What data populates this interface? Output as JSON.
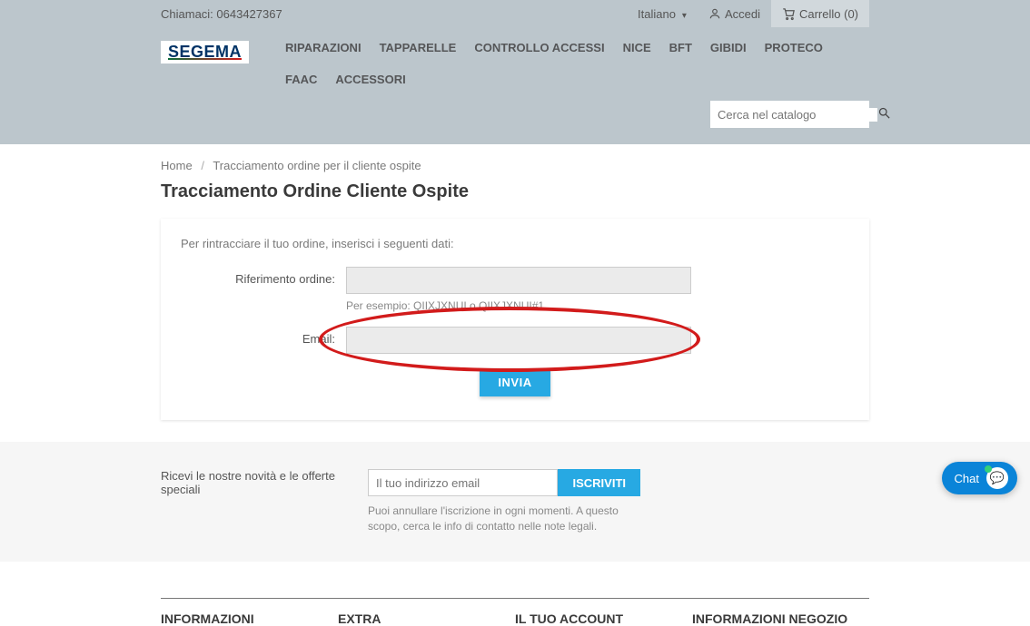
{
  "topbar": {
    "phone_label": "Chiamaci: 0643427367",
    "language": "Italiano",
    "login": "Accedi",
    "cart": "Carrello (0)"
  },
  "logo_text": "SEGEMA",
  "nav": [
    "RIPARAZIONI",
    "TAPPARELLE",
    "CONTROLLO ACCESSI",
    "NICE",
    "BFT",
    "GIBIDI",
    "PROTECO",
    "FAAC",
    "ACCESSORI"
  ],
  "search": {
    "placeholder": "Cerca nel catalogo"
  },
  "breadcrumb": {
    "home": "Home",
    "current": "Tracciamento ordine per il cliente ospite"
  },
  "page_title": "Tracciamento Ordine Cliente Ospite",
  "form": {
    "intro": "Per rintracciare il tuo ordine, inserisci i seguenti dati:",
    "ref_label": "Riferimento ordine:",
    "ref_help": "Per esempio: QIIXJXNUI o QIIXJXNUI#1",
    "email_label": "Email:",
    "submit": "INVIA"
  },
  "newsletter": {
    "label": "Ricevi le nostre novità e le offerte speciali",
    "placeholder": "Il tuo indirizzo email",
    "button": "ISCRIVITI",
    "help": "Puoi annullare l'iscrizione in ogni momenti. A questo scopo, cerca le info di contatto nelle note legali."
  },
  "footer_cols": [
    "INFORMAZIONI",
    "EXTRA",
    "IL TUO ACCOUNT",
    "INFORMAZIONI NEGOZIO"
  ],
  "chat": {
    "label": "Chat"
  }
}
